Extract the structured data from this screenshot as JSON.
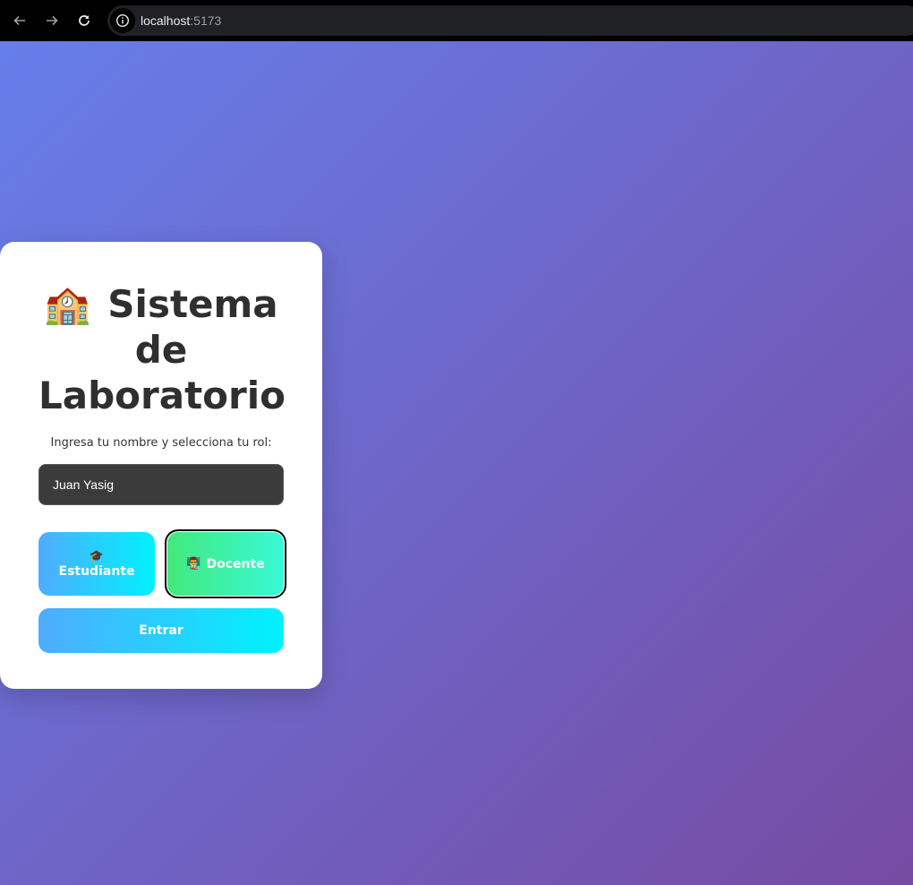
{
  "browser": {
    "url_host": "localhost",
    "url_port": ":5173"
  },
  "login": {
    "title_icon": "🏫",
    "title": "Sistema de Laboratorio",
    "subtitle": "Ingresa tu nombre y selecciona tu rol:",
    "name_value": "Juan Yasig",
    "roles": [
      {
        "icon": "🎓",
        "label": "Estudiante",
        "selected": false
      },
      {
        "icon": "👨‍🏫",
        "label": "Docente",
        "selected": true
      }
    ],
    "submit_label": "Entrar"
  },
  "colors": {
    "background_start": "#667eea",
    "background_end": "#764ba2",
    "student_gradient": [
      "#4facfe",
      "#00f2fe"
    ],
    "teacher_gradient": [
      "#43e97b",
      "#38f9d7"
    ]
  }
}
